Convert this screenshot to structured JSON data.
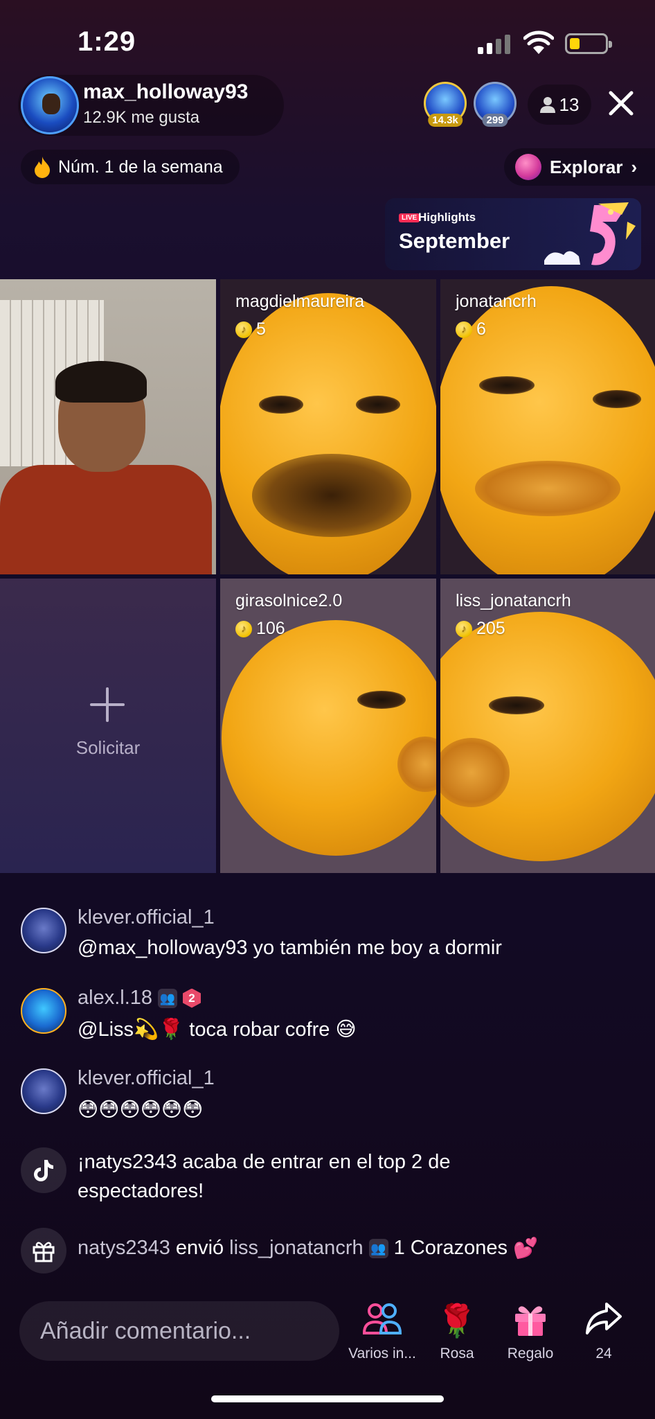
{
  "status_bar": {
    "time": "1:29"
  },
  "host": {
    "username": "max_holloway93",
    "likes": "12.9K me gusta"
  },
  "top_viewers": [
    {
      "badge": "14.3k"
    },
    {
      "badge": "299"
    }
  ],
  "viewer_count": "13",
  "rank_label": "Núm. 1 de la semana",
  "explore_label": "Explorar",
  "highlights": {
    "live_tag": "LIVE",
    "label": "Highlights",
    "month": "September"
  },
  "guests": [
    {
      "username": "magdielmaureira",
      "coins": "5"
    },
    {
      "username": "jonatancrh",
      "coins": "6"
    },
    {
      "username": "girasolnice2.0",
      "coins": "106"
    },
    {
      "username": "liss_jonatancrh",
      "coins": "205"
    }
  ],
  "request_label": "Solicitar",
  "chat": [
    {
      "user": "klever.official_1",
      "message": "@max_holloway93 yo también me boy a dormir"
    },
    {
      "user": "alex.l.18",
      "level": "2",
      "message_prefix": "@Liss",
      "message_suffix": "toca robar cofre"
    },
    {
      "user": "klever.official_1",
      "message": "😳😳😳😳😳😳"
    }
  ],
  "system_messages": {
    "top_entry": "¡natys2343 acaba de entrar en el top 2 de espectadores!",
    "gift_sender": "natys2343",
    "gift_verb": "envió",
    "gift_recipient": "liss_jonatancrh",
    "gift_item": "1 Corazones"
  },
  "comment": {
    "placeholder": "Añadir comentario..."
  },
  "actions": [
    {
      "label": "Varios in...",
      "icon": "multi-guest-icon"
    },
    {
      "label": "Rosa",
      "icon": "rose-icon"
    },
    {
      "label": "Regalo",
      "icon": "gift-icon"
    },
    {
      "label": "24",
      "icon": "share-icon"
    }
  ]
}
